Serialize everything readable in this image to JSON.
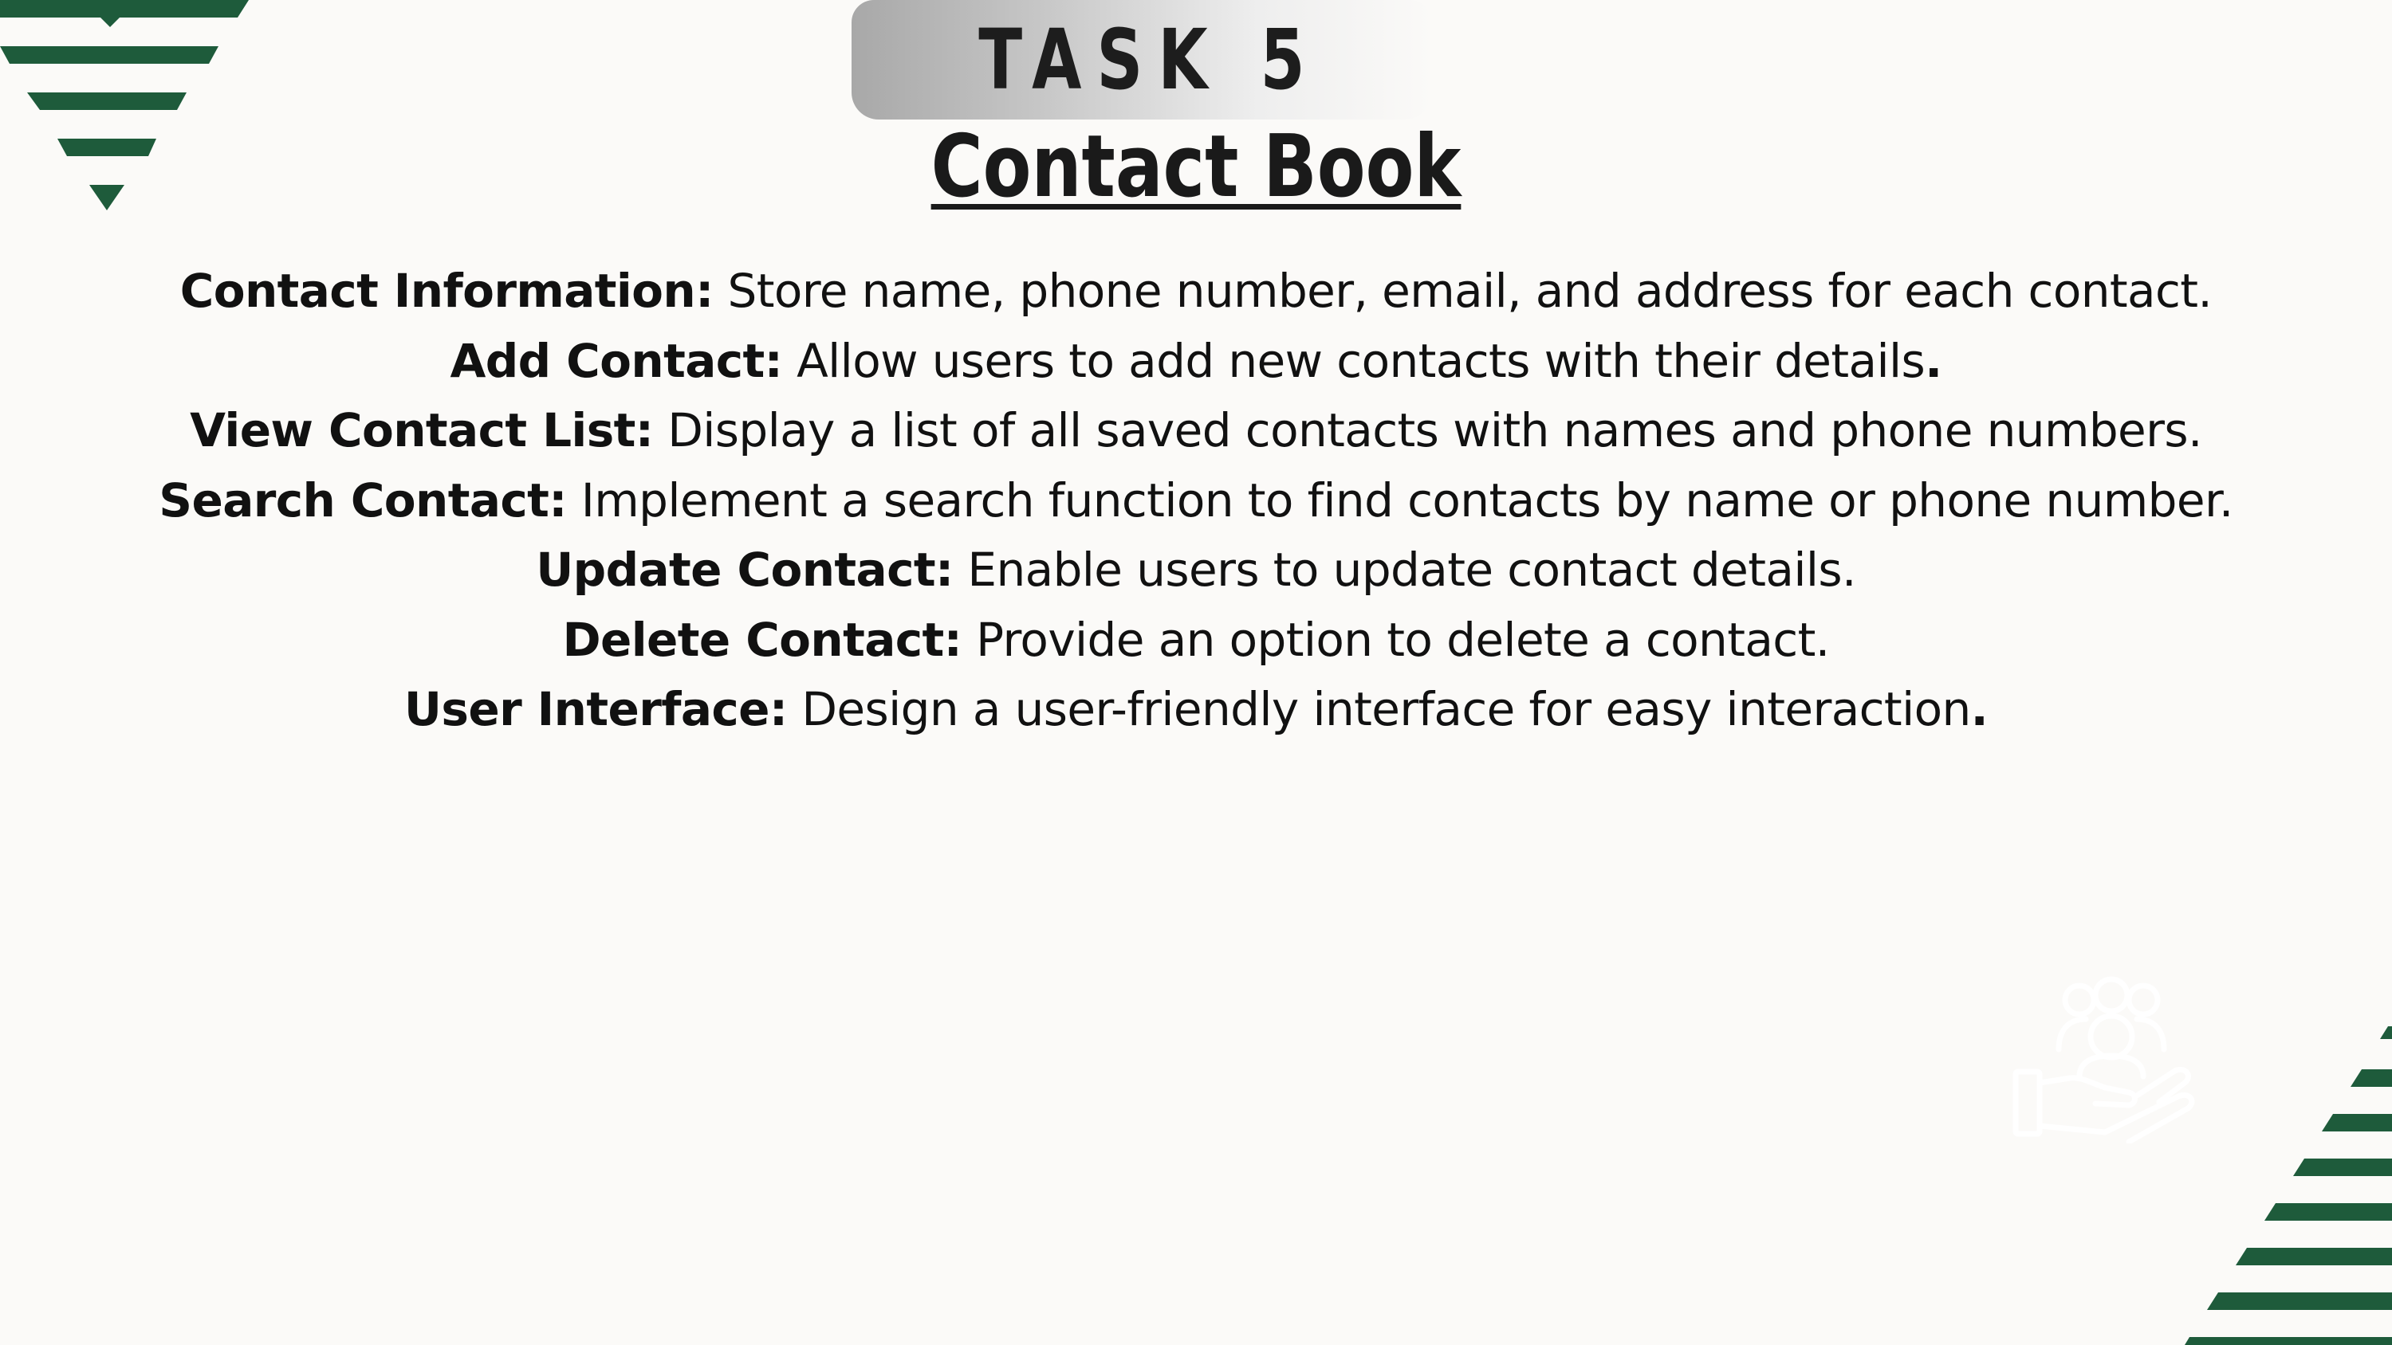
{
  "header": {
    "task_label": "TASK 5",
    "title": "Contact Book"
  },
  "features": [
    {
      "term": "Contact Information:",
      "text": " Store name, phone number, email, and address for each contact.",
      "end": ""
    },
    {
      "term": "Add Contact:",
      "text": " Allow users to add new contacts with their details",
      "end": "."
    },
    {
      "term": "View Contact List:",
      "text": " Display a list of all saved contacts with names and phone numbers.",
      "end": ""
    },
    {
      "term": "Search Contact:",
      "text": " Implement a search function to find contacts by name or phone number.",
      "end": ""
    },
    {
      "term": "Update Contact:",
      "text": " Enable users to update contact details.",
      "end": ""
    },
    {
      "term": "Delete Contact:",
      "text": " Provide an option to delete a contact.",
      "end": ""
    },
    {
      "term": "User Interface:",
      "text": " Design a user-friendly interface for easy interaction",
      "end": "."
    }
  ],
  "decor": {
    "accent_color": "#1e5b3b",
    "background_color": "#fbfaf8",
    "icon": "team-in-hand-icon"
  }
}
